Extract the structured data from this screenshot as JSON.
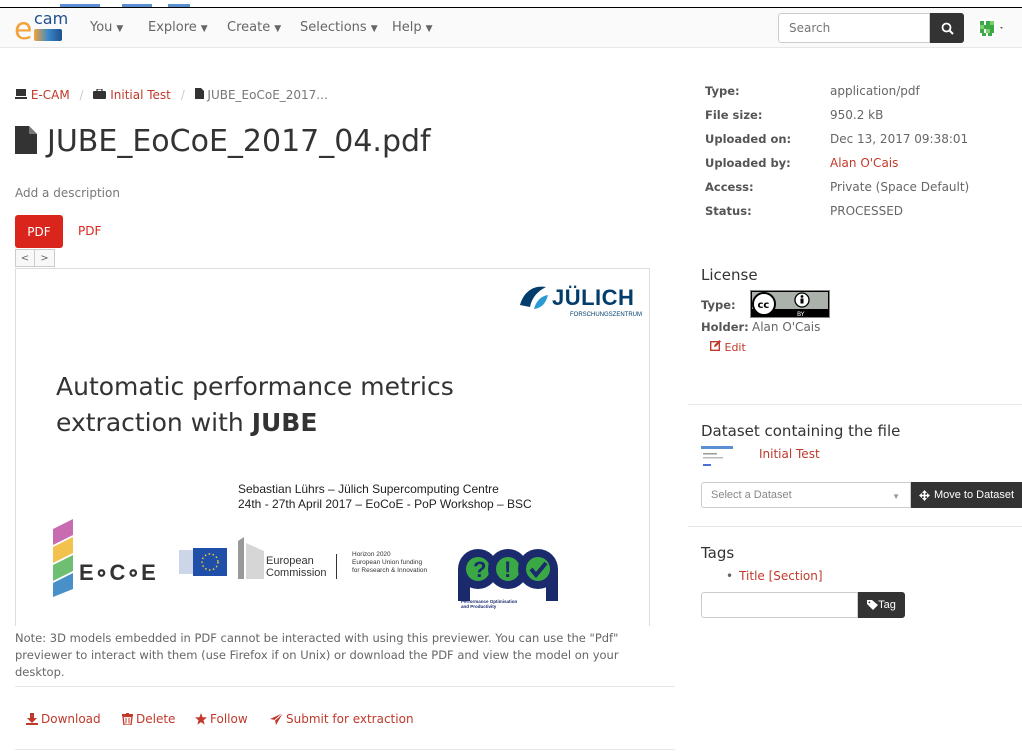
{
  "navbar": {
    "logo_small": "cam",
    "logo_big": "e",
    "items": [
      {
        "label": "You"
      },
      {
        "label": "Explore"
      },
      {
        "label": "Create"
      },
      {
        "label": "Selections"
      },
      {
        "label": "Help"
      }
    ],
    "search_placeholder": "Search"
  },
  "breadcrumb": {
    "space": "E-CAM",
    "dataset": "Initial Test",
    "file": "JUBE_EoCoE_2017..."
  },
  "file": {
    "title": "JUBE_EoCoE_2017_04.pdf",
    "add_description": "Add a description"
  },
  "previewer": {
    "active_tab": "PDF",
    "other_tab": "PDF",
    "prev": "<",
    "next": ">"
  },
  "slide": {
    "title_line1": "Automatic performance metrics",
    "title_line2_pre": "extraction with ",
    "title_line2_bold": "JUBE",
    "sub_line1": "Sebastian Lührs – Jülich Supercomputing Centre",
    "sub_line2": "24th - 27th April 2017 – EoCoE - PoP Workshop – BSC",
    "julich_name": "JÜLICH",
    "julich_sub": "FORSCHUNGSZENTRUM",
    "eocoe": "E∘C∘E",
    "ec_line1": "European",
    "ec_line2": "Commission",
    "h2020_line1": "Horizon 2020",
    "h2020_line2": "European Union funding",
    "h2020_line3": "for Research & Innovation",
    "pop_line1": "Performance Optimisation",
    "pop_line2": "and Productivity"
  },
  "note": "Note: 3D models embedded in PDF cannot be interacted with using this previewer. You can use the \"Pdf\" previewer to interact with them (use Firefox if on Unix) or download the PDF and view the model on your desktop.",
  "actions": {
    "download": "Download",
    "delete": "Delete",
    "follow": "Follow",
    "submit": "Submit for extraction"
  },
  "metadata": {
    "type_label": "Type:",
    "type_value": "application/pdf",
    "size_label": "File size:",
    "size_value": "950.2 kB",
    "uploaded_on_label": "Uploaded on:",
    "uploaded_on_value": "Dec 13, 2017 09:38:01",
    "uploaded_by_label": "Uploaded by:",
    "uploaded_by_value": "Alan O'Cais",
    "access_label": "Access:",
    "access_value": "Private (Space Default)",
    "status_label": "Status:",
    "status_value": "PROCESSED"
  },
  "license": {
    "heading": "License",
    "type_label": "Type:",
    "badge_text": "BY",
    "holder_label": "Holder:",
    "holder_value": "Alan O'Cais",
    "edit": "Edit"
  },
  "dataset": {
    "heading": "Dataset containing the file",
    "name": "Initial Test",
    "select_placeholder": "Select a Dataset",
    "move_button": "Move to Dataset"
  },
  "tags": {
    "heading": "Tags",
    "items": [
      "Title [Section]"
    ],
    "button": "Tag"
  },
  "colors": {
    "accent_red": "#d9251c",
    "link_red": "#c0392b",
    "dark_button": "#333333"
  }
}
